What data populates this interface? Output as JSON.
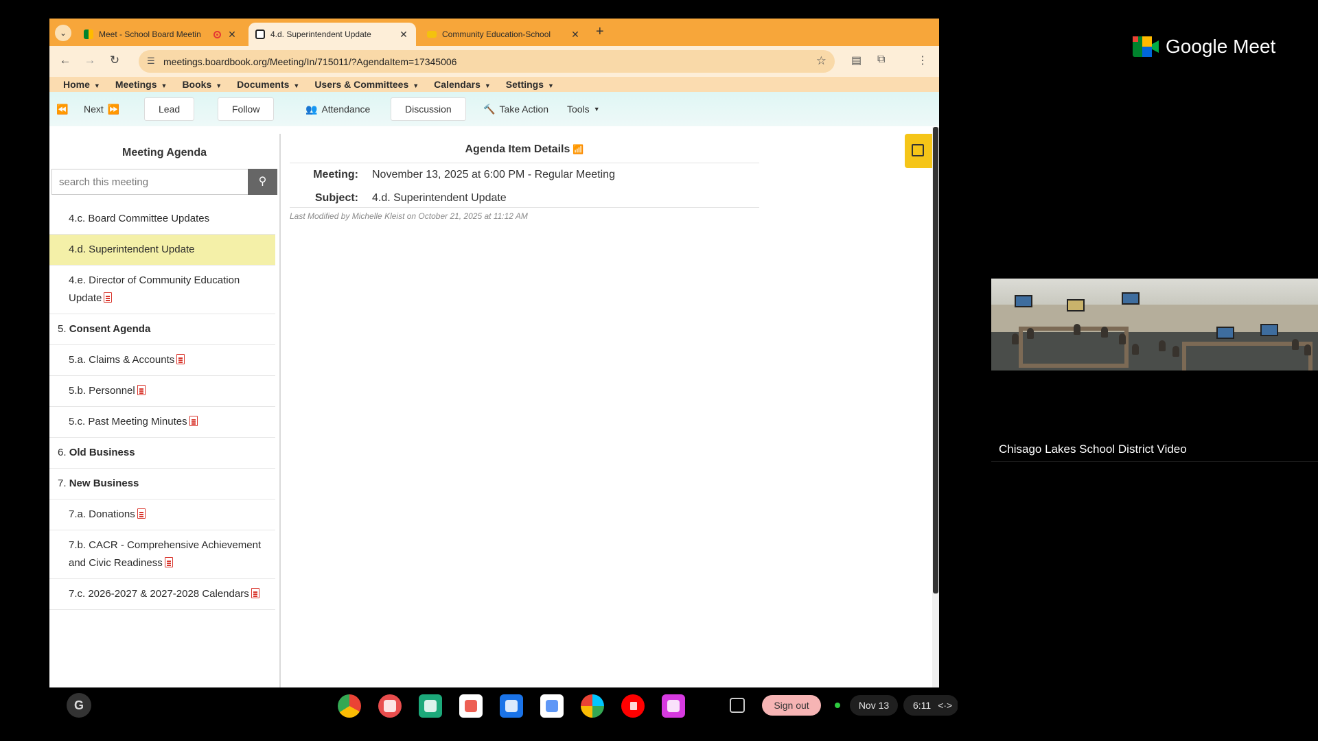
{
  "browser": {
    "tabs": [
      {
        "title": "Meet - School Board Meetin",
        "recording": true
      },
      {
        "title": "4.d. Superintendent Update",
        "active": true
      },
      {
        "title": "Community Education-School"
      }
    ],
    "url": "meetings.boardbook.org/Meeting/In/715011/?AgendaItem=17345006"
  },
  "site_menu": [
    "Home",
    "Meetings",
    "Books",
    "Documents",
    "Users & Committees",
    "Calendars",
    "Settings"
  ],
  "meeting_toolbar": {
    "next": "Next",
    "lead": "Lead",
    "follow": "Follow",
    "attendance": "Attendance",
    "discussion": "Discussion",
    "take_action": "Take Action",
    "tools": "Tools"
  },
  "sidebar": {
    "title": "Meeting Agenda",
    "search_placeholder": "search this meeting",
    "items": [
      {
        "label": "4.c. Board Committee Updates"
      },
      {
        "label": "4.d. Superintendent Update"
      },
      {
        "label": "4.e. Director of Community Education Update"
      },
      {
        "number": "5.",
        "label": "Consent Agenda"
      },
      {
        "label": "5.a. Claims & Accounts"
      },
      {
        "label": "5.b. Personnel"
      },
      {
        "label": "5.c. Past Meeting Minutes"
      },
      {
        "number": "6.",
        "label": "Old Business"
      },
      {
        "number": "7.",
        "label": "New Business"
      },
      {
        "label": "7.a. Donations"
      },
      {
        "label": "7.b. CACR - Comprehensive Achievement and Civic Readiness"
      },
      {
        "label": "7.c. 2026-2027 & 2027-2028 Calendars"
      }
    ]
  },
  "details": {
    "title": "Agenda Item Details",
    "meeting_label": "Meeting:",
    "meeting_value": "November 13, 2025 at 6:00 PM - Regular Meeting",
    "subject_label": "Subject:",
    "subject_value": "4.d. Superintendent Update",
    "last_modified": "Last Modified by Michelle Kleist on October 21, 2025 at 11:12 AM"
  },
  "shelf": {
    "sign_out": "Sign out",
    "date": "Nov 13",
    "time": "6:11",
    "launcher": "G"
  },
  "meet": {
    "brand": "Google Meet",
    "participant": "Chisago Lakes School District Video"
  },
  "colors": {
    "tab_strip": "#f7a63a",
    "selected_agenda": "#f4f0a8",
    "sign_out": "#f6b4b4",
    "note_tab": "#f5c518"
  }
}
